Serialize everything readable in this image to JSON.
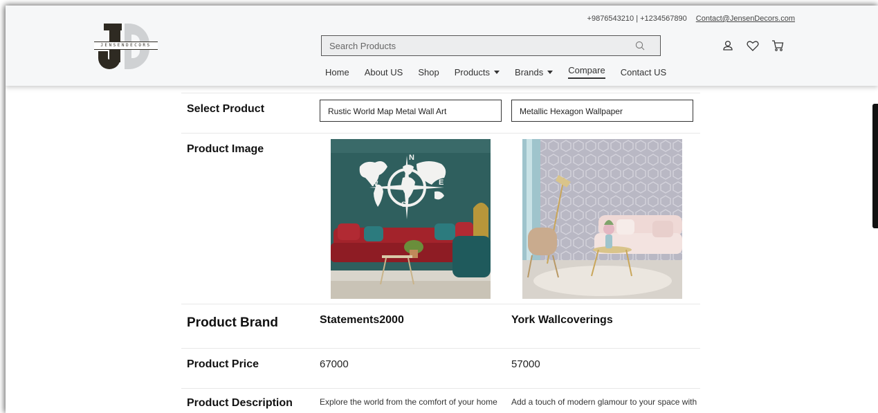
{
  "header": {
    "logo_text": "JENSENDECORS",
    "phones": "+9876543210 | +1234567890",
    "email": "Contact@JensenDecors.com",
    "search": {
      "placeholder": "Search Products",
      "icon": "search-icon"
    },
    "nav": [
      {
        "label": "Home",
        "dropdown": false,
        "active": false
      },
      {
        "label": "About US",
        "dropdown": false,
        "active": false
      },
      {
        "label": "Shop",
        "dropdown": false,
        "active": false
      },
      {
        "label": "Products",
        "dropdown": true,
        "active": false
      },
      {
        "label": "Brands",
        "dropdown": true,
        "active": false
      },
      {
        "label": "Compare",
        "dropdown": false,
        "active": true
      },
      {
        "label": "Contact US",
        "dropdown": false,
        "active": false
      }
    ],
    "icons": [
      "user-icon",
      "heart-icon",
      "cart-icon"
    ]
  },
  "compare": {
    "labels": {
      "select": "Select Product",
      "image": "Product Image",
      "brand": "Product Brand",
      "price": "Product Price",
      "description": "Product Description"
    },
    "products": [
      {
        "name": "Rustic World Map Metal Wall Art",
        "brand": "Statements2000",
        "price": "67000",
        "description": "Explore the world from the comfort of your home"
      },
      {
        "name": "Metallic Hexagon Wallpaper",
        "brand": "York Wallcoverings",
        "price": "57000",
        "description": "Add a touch of modern glamour to your space with"
      }
    ]
  },
  "colors": {
    "header_bg": "#f6f7f8",
    "logo_dark": "#2e2a22",
    "logo_light": "#cfd1d3",
    "teal_wall": "#2f5f5e",
    "red_sofa": "#a3232b"
  }
}
